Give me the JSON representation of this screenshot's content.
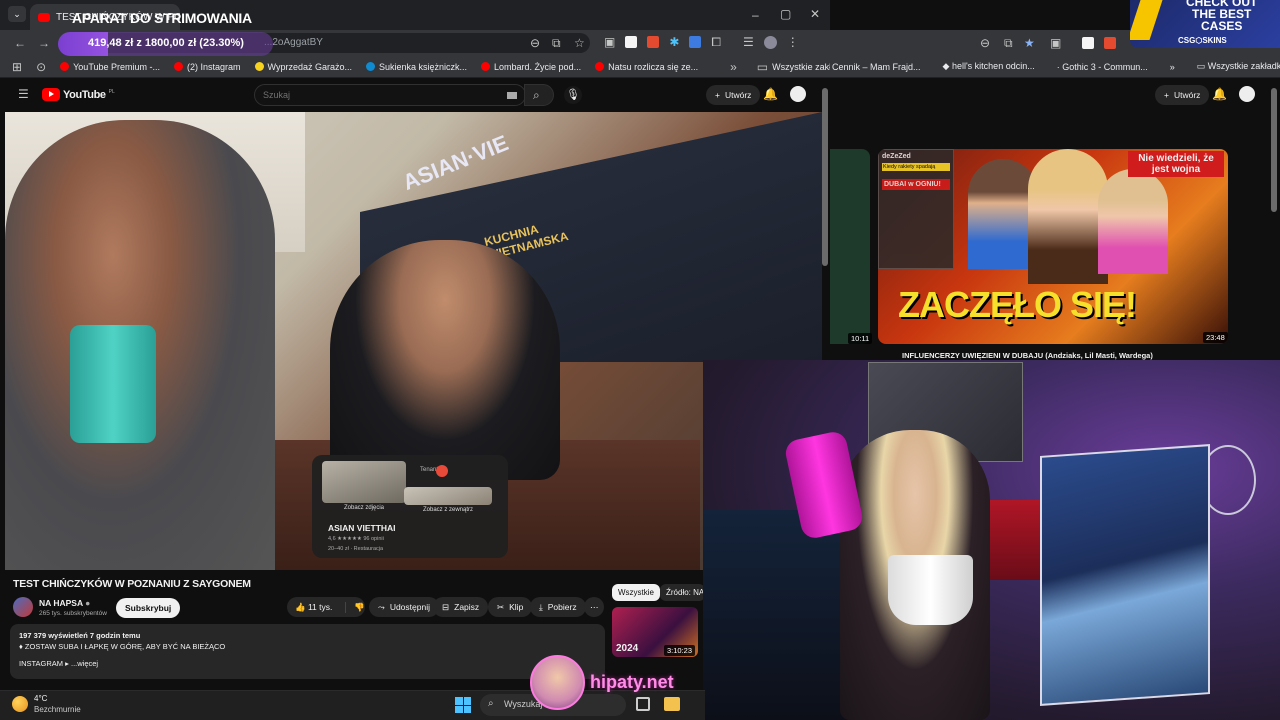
{
  "overlay": {
    "alert_title": "APARAT DO STRIMOWANIA",
    "goal_text": "419,48 zł z 1800,00 zł (23.30%)",
    "goal_progress": 0.233,
    "sponsor_line1": "CHECK OUT",
    "sponsor_line2": "THE BEST",
    "sponsor_line3": "CASES",
    "sponsor_brand": "CSG⬡SKINS",
    "hipaty_text": "hipaty.net"
  },
  "left_browser": {
    "tab_title": "TEST CHIŃCZYKÓW W PO...",
    "url_text": "...2oAggatBY",
    "bookmarks": [
      {
        "label": "YouTube Premium -...",
        "color": "#ff0000"
      },
      {
        "label": "(2) Instagram",
        "color": "#ff0000"
      },
      {
        "label": "Wyprzedaż Garażo...",
        "color": "#f7d21e"
      },
      {
        "label": "Sukienka księżniczk...",
        "color": "#0f8bd1"
      },
      {
        "label": "Lombard. Życie pod...",
        "color": "#ff0000"
      },
      {
        "label": "Natsu rozlicza się ze...",
        "color": "#ff0000"
      }
    ],
    "all_bookmarks": "Wszystkie zakładki"
  },
  "youtube": {
    "logo": "YouTube",
    "logo_region": "PL",
    "search_placeholder": "Szukaj",
    "create_label": "Utwórz",
    "video_title": "TEST CHIŃCZYKÓW W POZNANIU Z SAYGONEM",
    "channel_name": "NA HAPSA",
    "subscribers": "265 tys. subskrybentów",
    "subscribe_label": "Subskrybuj",
    "likes": "11 tys.",
    "share_label": "Udostępnij",
    "save_label": "Zapisz",
    "clip_label": "Klip",
    "download_label": "Pobierz",
    "desc_stats": "197 379 wyświetleń  7 godzin temu",
    "desc_line": "♦ ZOSTAW SUBA I ŁAPKĘ W GÓRĘ, ABY BYĆ NA BIEŻĄCO",
    "desc_more_prefix": "INSTAGRAM ▸",
    "desc_more": "...więcej",
    "chip_all": "Wszystkie",
    "chip_source": "Źródło: NA H",
    "side_thumb_year": "2024",
    "side_thumb_duration": "3:10:23",
    "map_card": {
      "place": "ASIAN VIETTHAI",
      "rating": "4,6 ★★★★★ 96 opinii",
      "meta": "20–40 zł · Restauracja",
      "photo_label": "Zobacz zdjęcia",
      "street_label": "Zobacz z zewnątrz",
      "tenant": "Tenant"
    },
    "sign_kuchnia": "KUCHNIA",
    "sign_wietnamska": "WIETNAMSKA",
    "sign_asian": "ASIAN·VIE"
  },
  "right_browser": {
    "bookmarks": [
      "Cennik – Mam Frajd...",
      "hell's kitchen odcin...",
      "Gothic 3 - Commun..."
    ],
    "all_bookmarks": "Wszystkie zakładki",
    "create_label": "Utwórz",
    "left_duration": "10:11",
    "thumb_headline": "ZACZĘŁO SIĘ!",
    "thumb_tag": "Nie wiedzieli, że jest wojna",
    "thumb_dubai": "DUBAI w OGNIU!",
    "thumb_user": "deZeZed",
    "thumb_rockets": "Kiedy rakiety spadają",
    "thumb_duration": "23:48",
    "video_title": "INFLUENCERZY UWIĘZIENI W DUBAJU (Andziaks, Lil Masti, Wardega)"
  },
  "taskbar": {
    "weather_temp": "4°C",
    "weather_desc": "Bezchmurnie",
    "search_placeholder": "Wyszukaj"
  }
}
